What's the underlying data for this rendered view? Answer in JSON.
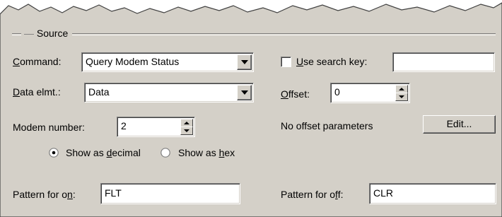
{
  "colors": {
    "dialog_bg": "#d4d0c8",
    "field_bg": "#ffffff",
    "shadow": "#808080"
  },
  "group": {
    "title": "Source"
  },
  "command": {
    "label_prefix": "",
    "label_mnemonic": "C",
    "label_rest": "ommand:",
    "value": "Query Modem Status"
  },
  "data_elmt": {
    "label_mnemonic": "D",
    "label_rest": "ata elmt.:",
    "value": "Data"
  },
  "modem_number": {
    "label": "Modem number:",
    "value": "2"
  },
  "show_as": {
    "decimal_prefix": "Show as ",
    "decimal_mnemonic": "d",
    "decimal_rest": "ecimal",
    "hex_prefix": "Show as ",
    "hex_mnemonic": "h",
    "hex_rest": "ex",
    "selected": "decimal"
  },
  "use_search_key": {
    "label_mnemonic": "U",
    "label_rest": "se search key:",
    "checked": false,
    "value": ""
  },
  "offset": {
    "label_mnemonic": "O",
    "label_rest": "ffset:",
    "value": "0"
  },
  "offset_params": {
    "text": "No offset parameters",
    "edit_label": "Edit..."
  },
  "pattern_on": {
    "label_prefix": "Pattern for o",
    "label_mnemonic": "n",
    "label_rest": ":",
    "value": "FLT"
  },
  "pattern_off": {
    "label_prefix": "Pattern for o",
    "label_mnemonic": "f",
    "label_rest": "f:",
    "value": "CLR"
  },
  "icons": {
    "dropdown": "chevron-down-icon",
    "spin_up": "spin-up-icon",
    "spin_down": "spin-down-icon"
  }
}
